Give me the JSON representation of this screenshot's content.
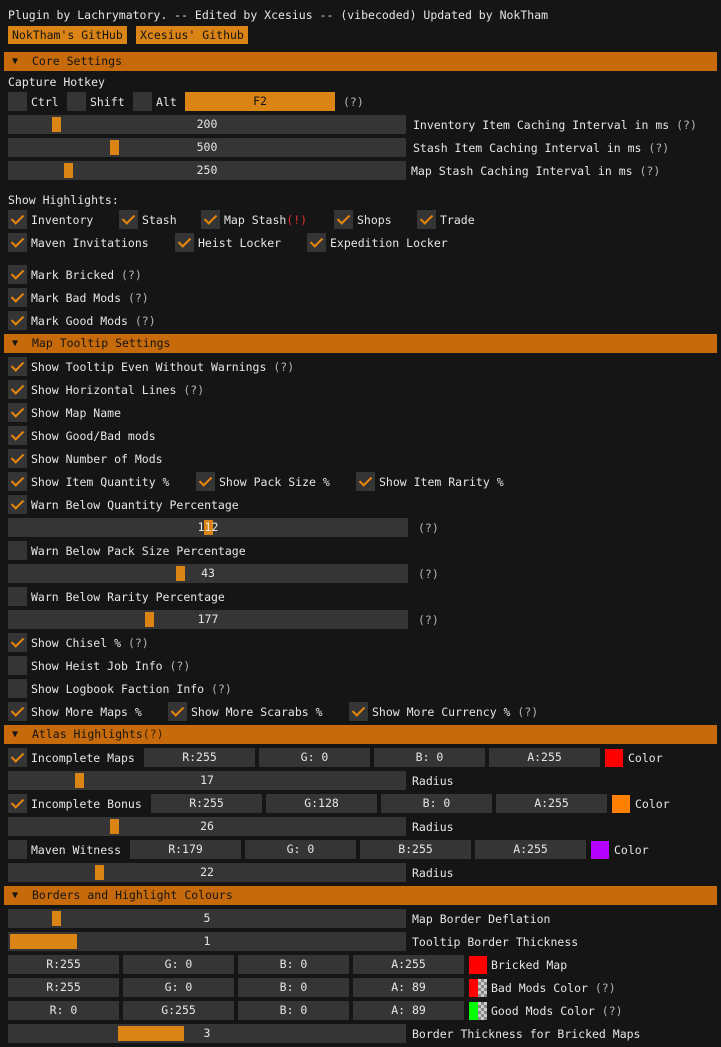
{
  "header_text": "Plugin by Lachrymatory. -- Edited by Xcesius -- (vibecoded) Updated by NokTham",
  "link_buttons": [
    "NokTham's GitHub",
    "Xcesius' Github"
  ],
  "q": "(?)",
  "excl": "(!)",
  "sections": {
    "core": "Core Settings",
    "map_tooltip": "Map Tooltip Settings",
    "atlas": "Atlas Highlights",
    "borders": "Borders and Highlight Colours"
  },
  "core": {
    "capture_hotkey": "Capture Hotkey",
    "mods": [
      "Ctrl",
      "Shift",
      "Alt"
    ],
    "hotkey": "F2",
    "sliders": [
      {
        "value": 200,
        "fraction": 0.11,
        "label": "Inventory Item Caching Interval in ms"
      },
      {
        "value": 500,
        "fraction": 0.26,
        "label": "Stash Item Caching Interval in ms"
      },
      {
        "value": 250,
        "fraction": 0.14,
        "label": "Map Stash Caching Interval in ms"
      }
    ],
    "show_highlights": "Show Highlights:",
    "hl_row1": [
      "Inventory",
      "Stash",
      "Map Stash",
      "Shops",
      "Trade"
    ],
    "hl_row2": [
      "Maven Invitations",
      "Heist Locker",
      "Expedition Locker"
    ],
    "marks": [
      "Mark Bricked",
      "Mark Bad Mods",
      "Mark Good Mods"
    ]
  },
  "tooltip": {
    "items": [
      "Show Tooltip Even Without Warnings",
      "Show Horizontal Lines",
      "Show Map Name",
      "Show Good/Bad mods",
      "Show Number of Mods"
    ],
    "row3": [
      "Show Item Quantity %",
      "Show Pack Size %",
      "Show Item Rarity %"
    ],
    "warn_qty": "Warn Below Quantity Percentage",
    "qty_value": 112,
    "qty_fraction": 0.5,
    "warn_pack": "Warn Below Pack Size Percentage",
    "pack_value": 43,
    "pack_fraction": 0.43,
    "warn_rarity": "Warn Below Rarity Percentage",
    "rarity_value": 177,
    "rarity_fraction": 0.35,
    "chisel": "Show Chisel %",
    "heist": "Show Heist Job Info",
    "logbook": "Show Logbook Faction Info",
    "more": [
      "Show More Maps %",
      "Show More Scarabs %",
      "Show More Currency %"
    ]
  },
  "atlas": {
    "color": "Color",
    "radius": "Radius",
    "rows": [
      {
        "name": "Incomplete Maps",
        "r": "R:255",
        "g": "G:  0",
        "b": "B:  0",
        "a": "A:255",
        "swatch": "#ff0000",
        "radius": 17,
        "fraction": 0.17
      },
      {
        "name": "Incomplete Bonus",
        "r": "R:255",
        "g": "G:128",
        "b": "B:  0",
        "a": "A:255",
        "swatch": "#ff8000",
        "radius": 26,
        "fraction": 0.26
      },
      {
        "name": "Maven Witness",
        "r": "R:179",
        "g": "G:  0",
        "b": "B:255",
        "a": "A:255",
        "swatch": "#b300ff",
        "radius": 22,
        "fraction": 0.22
      }
    ]
  },
  "borders": {
    "deflation_value": 5,
    "deflation_fraction": 0.11,
    "deflation_label": "Map Border Deflation",
    "tooltip_thickness_value": 1,
    "tooltip_thickness_fraction": 0.17,
    "tooltip_thickness_label": "Tooltip Border Thickness",
    "colors": [
      {
        "r": "R:255",
        "g": "G:  0",
        "b": "B:  0",
        "a": "A:255",
        "swatch": "#ff0000",
        "label": "Bricked Map"
      },
      {
        "r": "R:255",
        "g": "G:  0",
        "b": "B:  0",
        "a": "A: 89",
        "swatch": "#ff0000",
        "label": "Bad Mods Color"
      },
      {
        "r": "R:  0",
        "g": "G:255",
        "b": "B:  0",
        "a": "A: 89",
        "swatch": "#00ff00",
        "label": "Good Mods Color"
      }
    ],
    "bricked_thickness_value": 3,
    "bricked_thickness_fraction": 0.33,
    "bricked_thickness_label": "Border Thickness for Bricked Maps"
  },
  "accent": "#d98414"
}
